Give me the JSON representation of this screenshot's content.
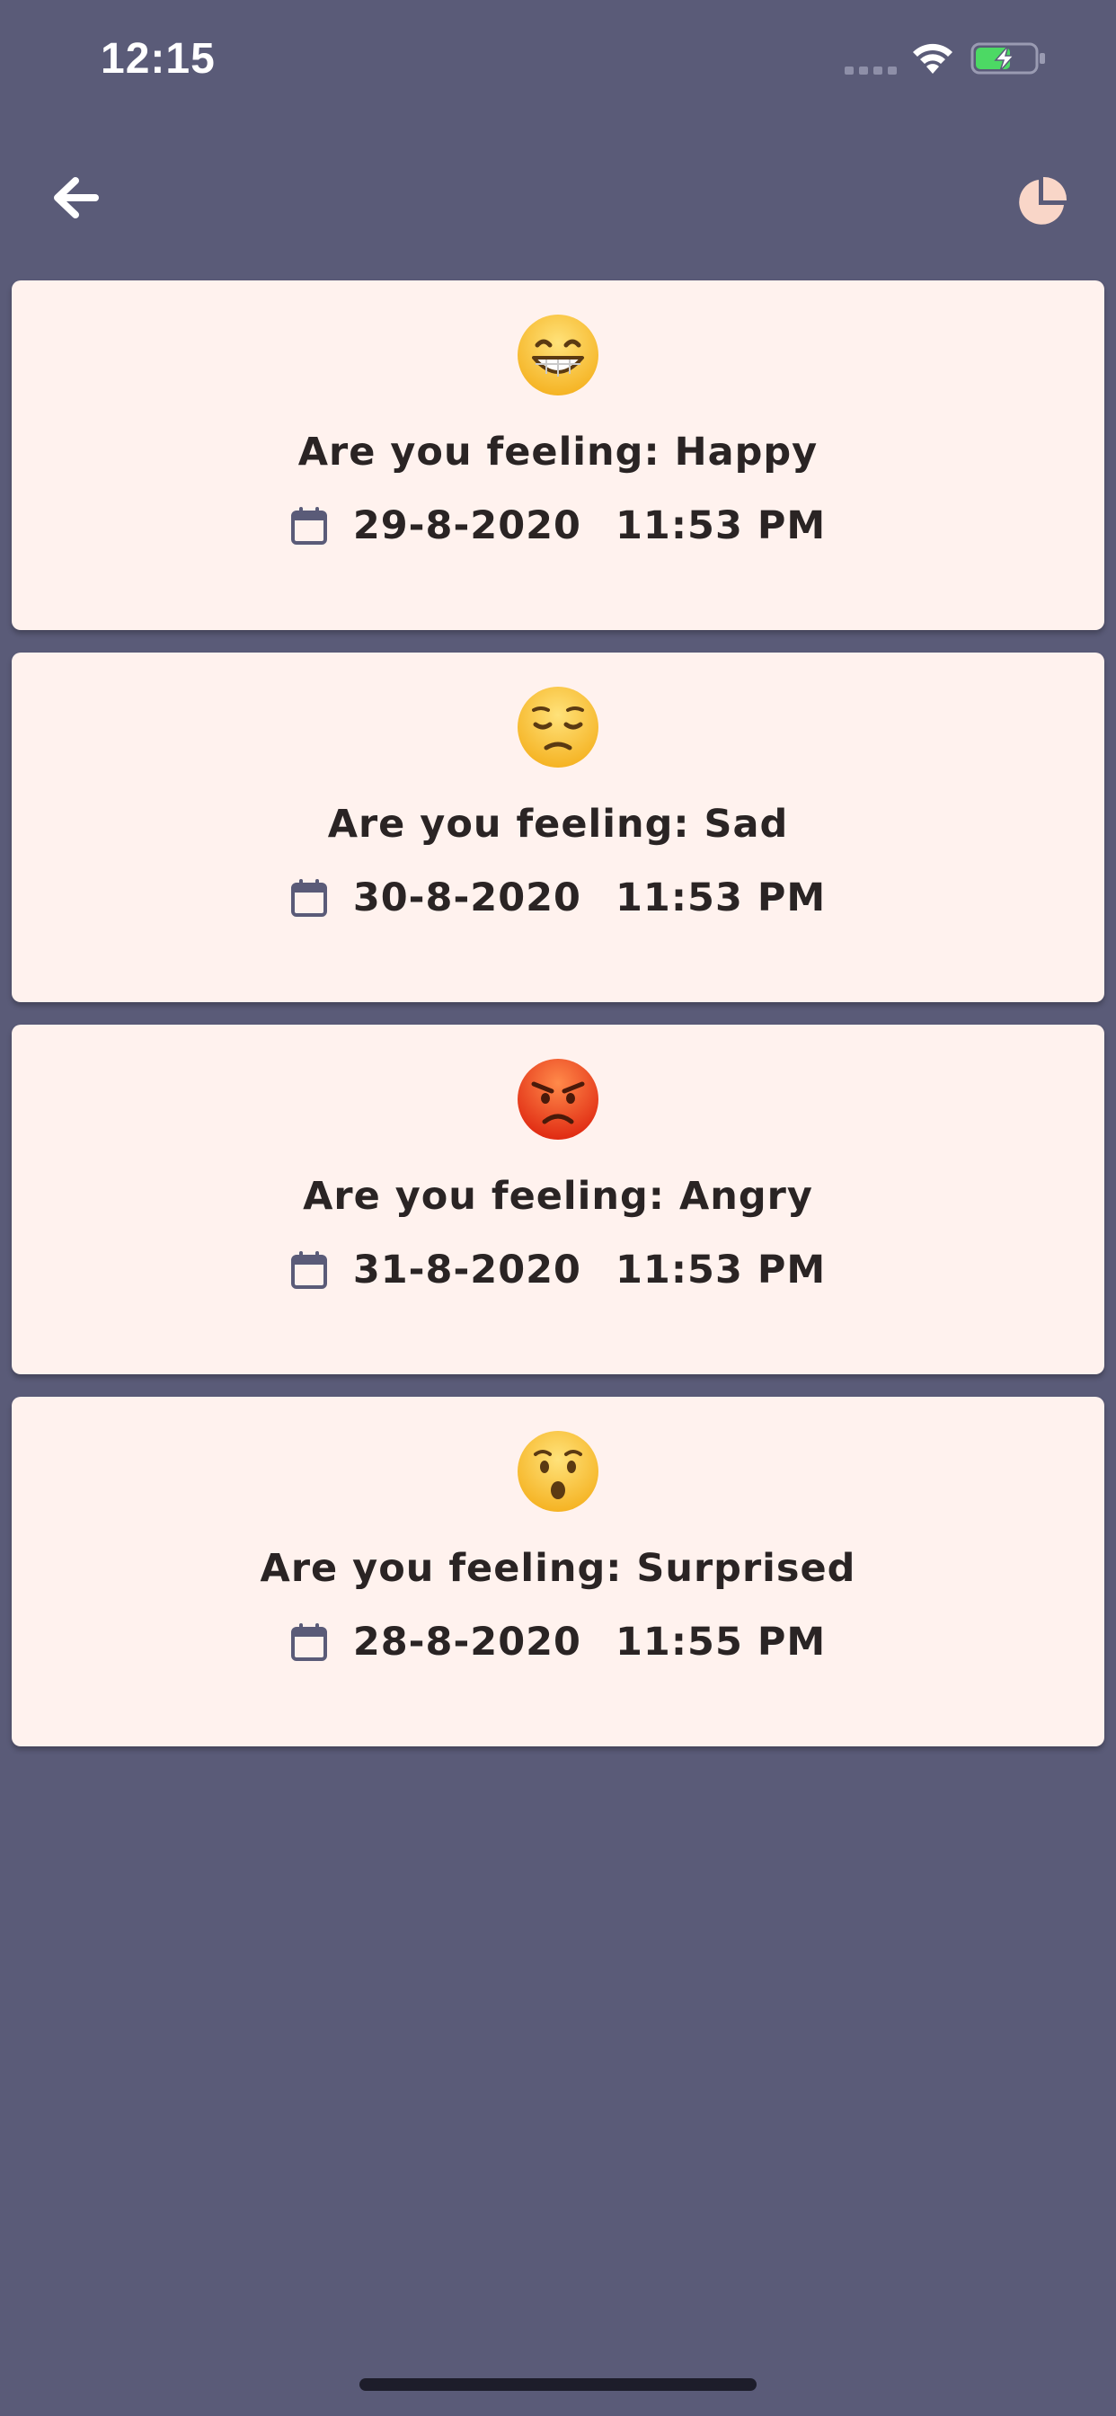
{
  "status_bar": {
    "time": "12:15",
    "icons": [
      "signal-icon",
      "wifi-icon",
      "battery-charging-icon"
    ]
  },
  "app_bar": {
    "back_icon": "arrow-left-icon",
    "chart_icon": "pie-chart-icon"
  },
  "entries": [
    {
      "emoji": "grinning-face-icon",
      "title": "Are you feeling: Happy",
      "date": "29-8-2020",
      "time": "11:53 PM"
    },
    {
      "emoji": "pensive-face-icon",
      "title": "Are you feeling: Sad",
      "date": "30-8-2020",
      "time": "11:53 PM"
    },
    {
      "emoji": "angry-face-icon",
      "title": "Are you feeling: Angry",
      "date": "31-8-2020",
      "time": "11:53 PM"
    },
    {
      "emoji": "hushed-face-icon",
      "title": "Are you feeling: Surprised",
      "date": "28-8-2020",
      "time": "11:55 PM"
    }
  ],
  "colors": {
    "background": "#5a5b78",
    "card": "#fff2ee",
    "text": "#2a2424",
    "accent_icon": "#f9d6c8"
  }
}
